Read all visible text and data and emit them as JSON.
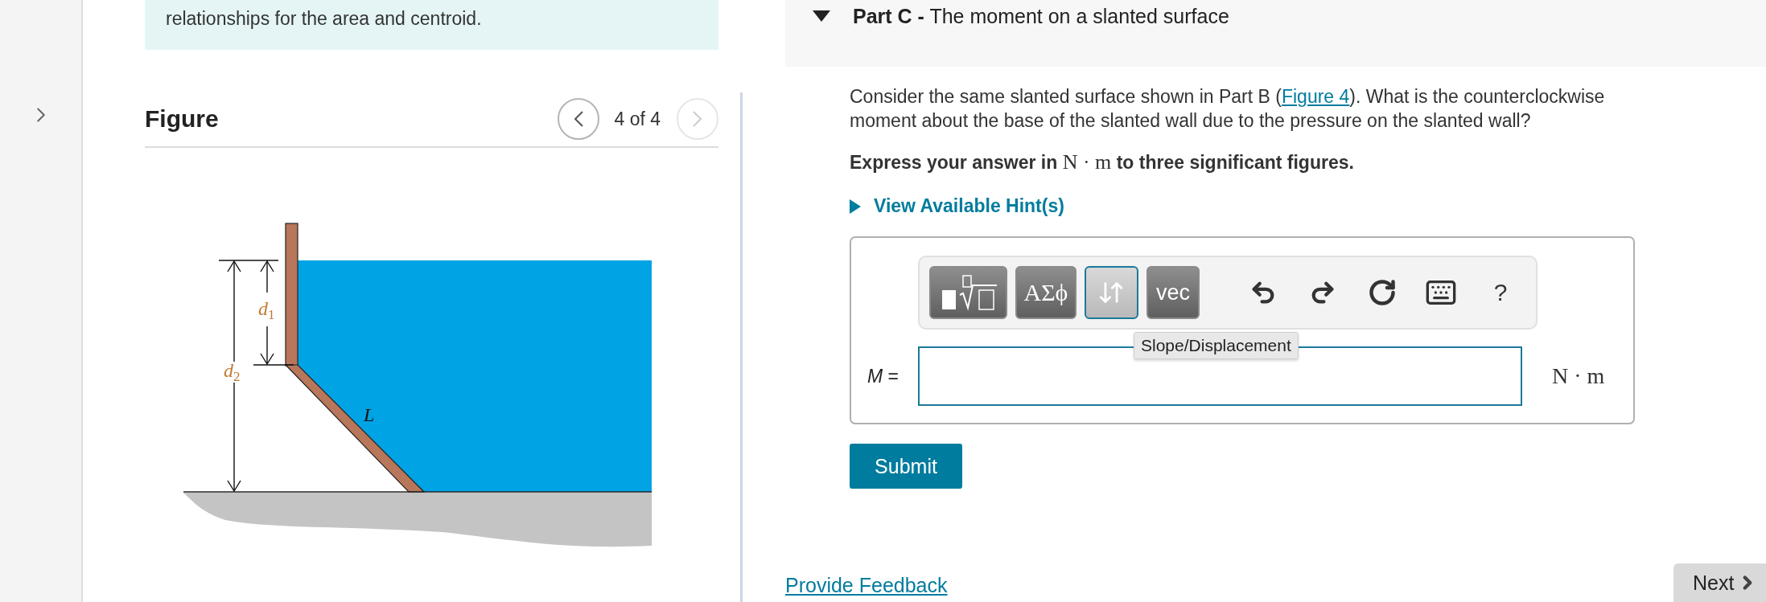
{
  "intro": {
    "text": "relationships for the area and centroid."
  },
  "figure": {
    "title": "Figure",
    "counter": "4 of 4",
    "nav": [
      {
        "kind": "prev",
        "disabled": false
      },
      {
        "kind": "next",
        "disabled": true
      }
    ],
    "labels": [
      {
        "kind": "d1",
        "letter": "d",
        "index": "1"
      },
      {
        "kind": "d2",
        "letter": "d",
        "index": "2"
      },
      {
        "kind": "L",
        "letter": "L"
      }
    ]
  },
  "part": {
    "expanded": true,
    "title": "**Part C -** The moment on a slanted surface",
    "question": {
      "before": "Consider the same slanted surface shown in Part B (",
      "link": "Figure 4",
      "after": "). What is the counterclockwise moment about the base of the slanted wall due to the pressure on the slanted wall?"
    },
    "instruction": {
      "before": "Express your answer in ",
      "unit": "N · m",
      "after": " to three significant figures."
    },
    "hint": {
      "label": "View Available Hint(s)",
      "expanded": false
    },
    "toolbar": {
      "buttons": [
        {
          "kind": "templates",
          "selected": false
        },
        {
          "kind": "text",
          "label": "ΑΣϕ",
          "selected": false
        },
        {
          "kind": "arrows",
          "selected": true
        },
        {
          "kind": "text",
          "label": "vec",
          "selected": false
        }
      ],
      "actions": [
        {
          "kind": "undo"
        },
        {
          "kind": "redo"
        },
        {
          "kind": "reset"
        },
        {
          "kind": "keyboard"
        },
        {
          "kind": "help",
          "label": "?"
        }
      ]
    },
    "tooltip": "Slope/Displacement",
    "answer": {
      "label": "M",
      "equals": "=",
      "unit": "N · m"
    },
    "submit": "Submit"
  },
  "footer": {
    "feedback": "Provide Feedback",
    "next": "Next"
  }
}
